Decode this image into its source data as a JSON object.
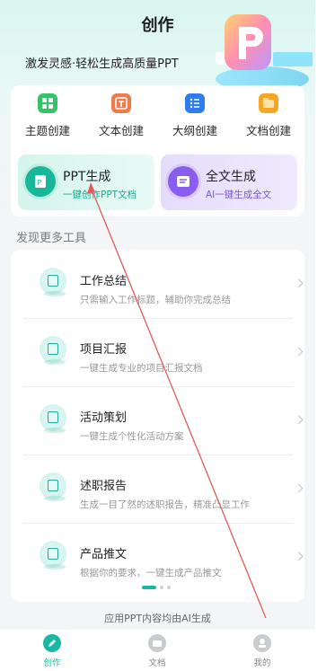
{
  "header": {
    "title": "创作",
    "subtitle": "激发灵感·轻松生成高质量PPT"
  },
  "quick_actions": [
    {
      "label": "主题创建",
      "icon": "grid-icon",
      "color": "#33c46a"
    },
    {
      "label": "文本创建",
      "icon": "text-box-icon",
      "color": "#f07a4a"
    },
    {
      "label": "大纲创建",
      "icon": "list-icon",
      "color": "#2d7df0"
    },
    {
      "label": "文档创建",
      "icon": "folder-icon",
      "color": "#f5a623"
    }
  ],
  "feature_cards": [
    {
      "title": "PPT生成",
      "subtitle": "一键创作PPT文档",
      "color": "#18b69a"
    },
    {
      "title": "全文生成",
      "subtitle": "AI一键生成全文",
      "color": "#8a5cf0"
    }
  ],
  "section_title": "发现更多工具",
  "tools": [
    {
      "title": "工作总结",
      "desc": "只需输入工作标题，辅助你完成总结",
      "icon": "book-icon"
    },
    {
      "title": "项目汇报",
      "desc": "一键生成专业的项目汇报文档",
      "icon": "open-book-icon"
    },
    {
      "title": "活动策划",
      "desc": "一键生成个性化活动方案",
      "icon": "edit-doc-icon"
    },
    {
      "title": "述职报告",
      "desc": "生成一目了然的述职报告，精准凸显工作",
      "icon": "text-doc-icon"
    },
    {
      "title": "产品推文",
      "desc": "根据你的要求，一键生成产品推文",
      "icon": "note-icon"
    }
  ],
  "footer_note": "应用PPT内容均由AI生成",
  "tabs": [
    {
      "label": "创作",
      "active": true,
      "icon": "pen-icon"
    },
    {
      "label": "文档",
      "active": false,
      "icon": "folder-icon"
    },
    {
      "label": "我的",
      "active": false,
      "icon": "user-icon"
    }
  ],
  "colors": {
    "accent": "#18b69a",
    "purple": "#8a5cf0",
    "annotation_arrow": "#e35a5a"
  }
}
